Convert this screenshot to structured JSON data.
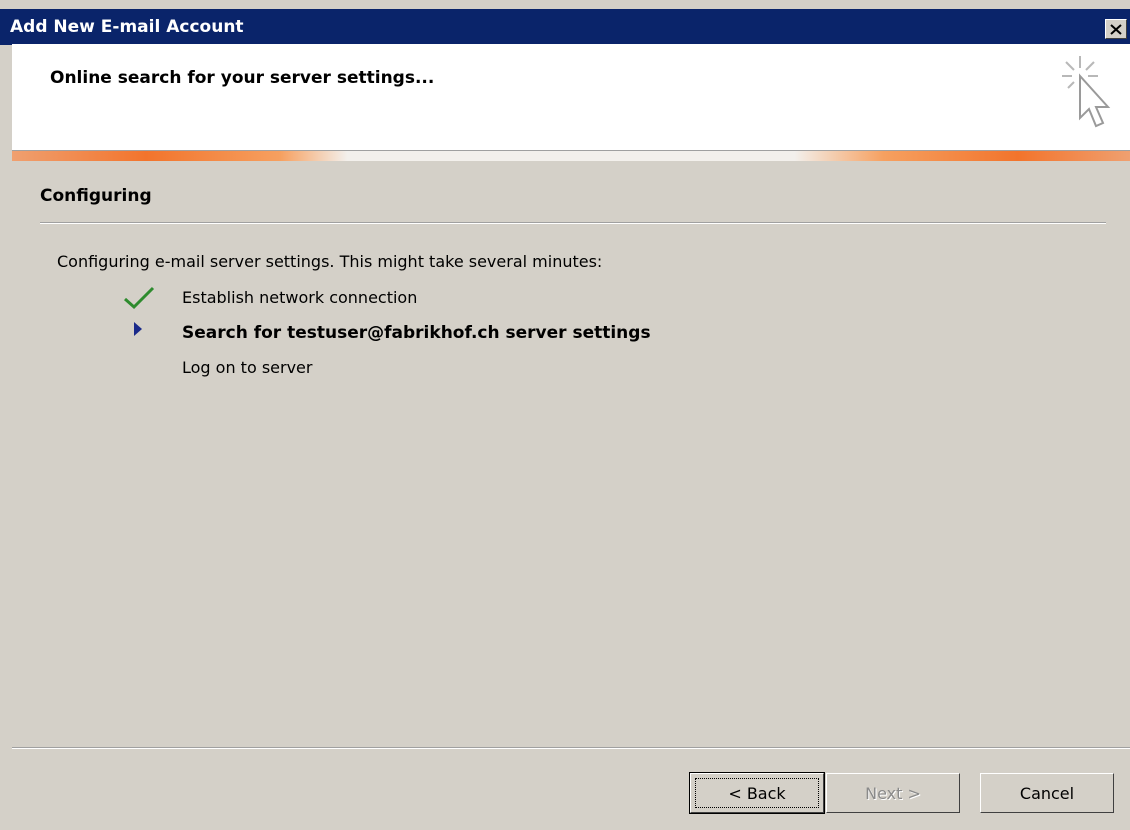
{
  "window": {
    "title": "Add New E-mail Account",
    "close_icon": "close-icon"
  },
  "header": {
    "heading": "Online search for your server settings...",
    "icon": "wizard-cursor-sparkle-icon"
  },
  "section": {
    "title": "Configuring",
    "intro": "Configuring e-mail server settings. This might take several minutes:"
  },
  "steps": [
    {
      "label": "Establish network connection",
      "status": "done",
      "icon": "checkmark-icon"
    },
    {
      "label": "Search for testuser@fabrikhof.ch server settings",
      "status": "in-progress",
      "icon": "arrow-right-icon"
    },
    {
      "label": "Log on to server",
      "status": "pending",
      "icon": ""
    }
  ],
  "buttons": {
    "back": "< Back",
    "next": "Next >",
    "cancel": "Cancel"
  },
  "colors": {
    "titlebar": "#0a246a",
    "dialog_bg": "#d4d0c8",
    "check": "#2e8b2e",
    "arrow": "#1a2a8a",
    "accent_band": "#f2742c"
  }
}
